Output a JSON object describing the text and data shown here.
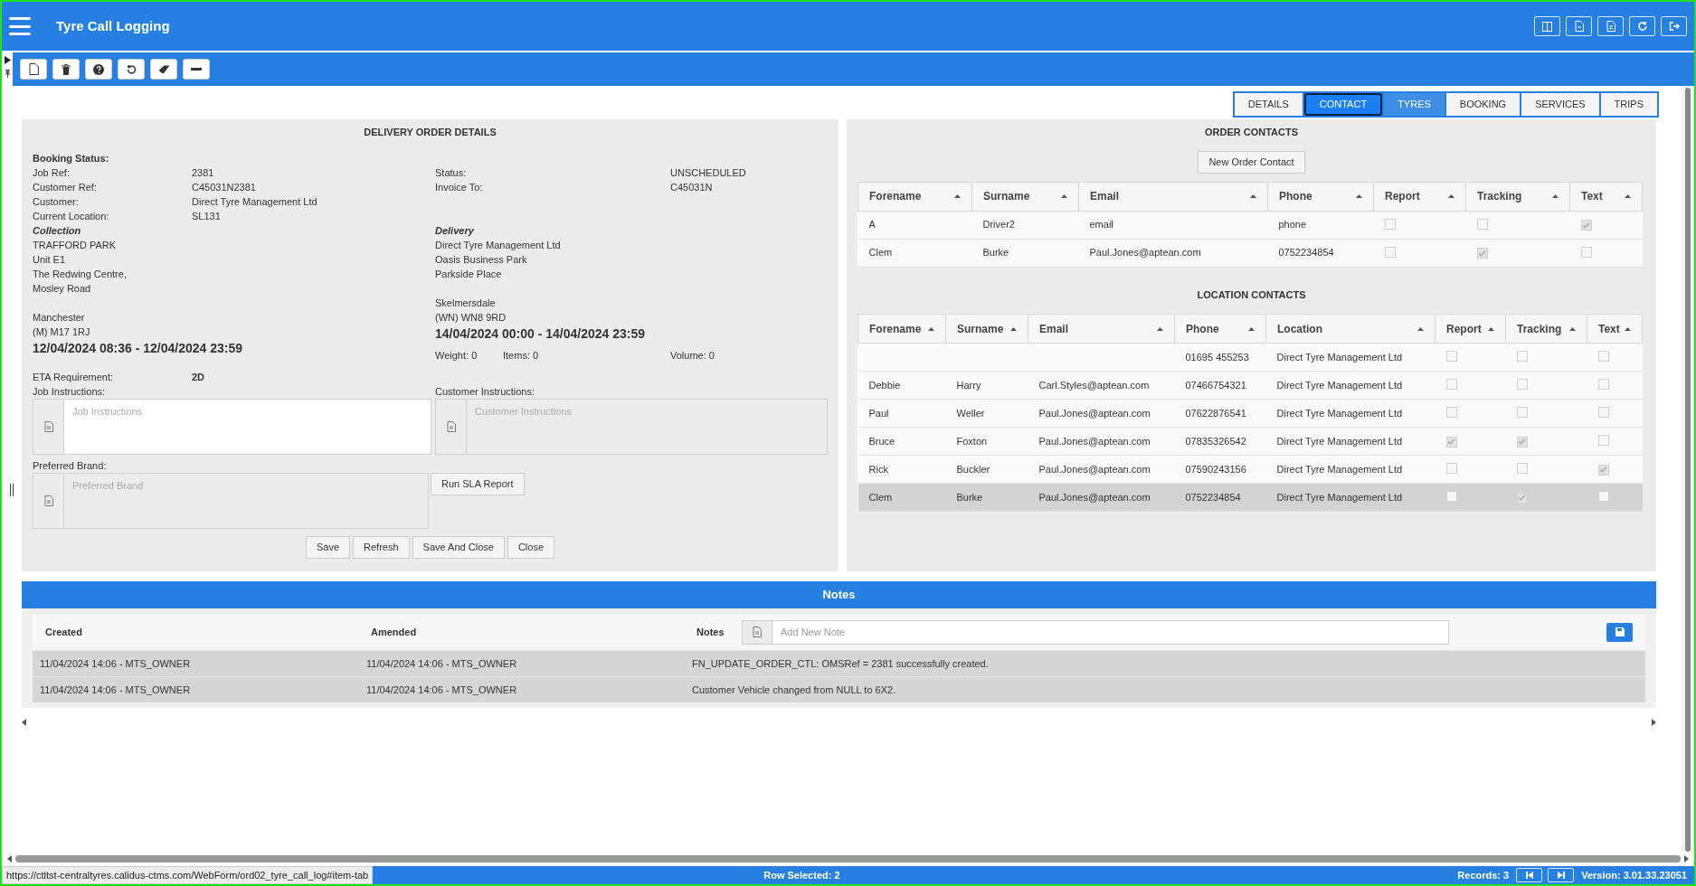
{
  "header": {
    "title": "Tyre Call Logging"
  },
  "tabs": [
    {
      "label": "DETAILS",
      "selected": false,
      "hovered": false
    },
    {
      "label": "CONTACT",
      "selected": true,
      "hovered": false
    },
    {
      "label": "TYRES",
      "selected": false,
      "hovered": true
    },
    {
      "label": "BOOKING",
      "selected": false,
      "hovered": false
    },
    {
      "label": "SERVICES",
      "selected": false,
      "hovered": false
    },
    {
      "label": "TRIPS",
      "selected": false,
      "hovered": false
    }
  ],
  "details": {
    "title": "DELIVERY ORDER DETAILS",
    "booking_status_label": "Booking Status:",
    "left_fields": [
      {
        "label": "Job Ref:",
        "value": "2381"
      },
      {
        "label": "Customer Ref:",
        "value": "C45031N2381"
      },
      {
        "label": "Customer:",
        "value": "Direct Tyre Management Ltd"
      },
      {
        "label": "Current Location:",
        "value": "SL131"
      }
    ],
    "right_fields": [
      {
        "label": "Status:",
        "value": "UNSCHEDULED"
      },
      {
        "label": "Invoice To:",
        "value": "C45031N"
      }
    ],
    "collection": {
      "heading": "Collection",
      "lines": [
        "TRAFFORD PARK",
        "Unit E1",
        "The Redwing Centre,",
        "Mosley Road"
      ],
      "town": "Manchester",
      "postcode": "(M) M17 1RJ",
      "window": "12/04/2024 08:36 - 12/04/2024 23:59"
    },
    "delivery": {
      "heading": "Delivery",
      "lines": [
        "Direct Tyre Management Ltd",
        "Oasis Business Park",
        "Parkside Place"
      ],
      "town": "Skelmersdale",
      "postcode": "(WN) WN8 9RD",
      "window": "14/04/2024 00:00 - 14/04/2024 23:59"
    },
    "weight": "Weight:  0",
    "items": "Items:  0",
    "volume": "Volume:  0",
    "eta_label": "ETA Requirement:",
    "eta_value": "2D",
    "job_instructions": {
      "label": "Job Instructions:",
      "placeholder": "Job Instructions",
      "disabled": false
    },
    "customer_instructions": {
      "label": "Customer Instructions:",
      "placeholder": "Customer Instructions",
      "disabled": true
    },
    "preferred_brand": {
      "label": "Preferred Brand:",
      "placeholder": "Preferred Brand",
      "disabled": true
    },
    "sla_button": "Run SLA Report",
    "buttons": [
      "Save",
      "Refresh",
      "Save And Close",
      "Close"
    ]
  },
  "order_contacts": {
    "title": "ORDER CONTACTS",
    "new_button": "New Order Contact",
    "columns": [
      "Forename",
      "Surname",
      "Email",
      "Phone",
      "Report",
      "Tracking",
      "Text"
    ],
    "rows": [
      {
        "forename": "A",
        "surname": "Driver2",
        "email": "email",
        "phone": "phone",
        "report": false,
        "tracking": false,
        "text": true
      },
      {
        "forename": "Clem",
        "surname": "Burke",
        "email": "Paul.Jones@aptean.com",
        "phone": "0752234854",
        "report": false,
        "tracking": true,
        "text": false
      }
    ]
  },
  "location_contacts": {
    "title": "LOCATION CONTACTS",
    "columns": [
      "Forename",
      "Surname",
      "Email",
      "Phone",
      "Location",
      "Report",
      "Tracking",
      "Text"
    ],
    "rows": [
      {
        "forename": "",
        "surname": "",
        "email": "",
        "phone": "01695 455253",
        "location": "Direct Tyre Management Ltd",
        "report": false,
        "tracking": false,
        "text": false,
        "selected": false
      },
      {
        "forename": "Debbie",
        "surname": "Harry",
        "email": "Carl.Styles@aptean.com",
        "phone": "07466754321",
        "location": "Direct Tyre Management Ltd",
        "report": false,
        "tracking": false,
        "text": false,
        "selected": false
      },
      {
        "forename": "Paul",
        "surname": "Weller",
        "email": "Paul.Jones@aptean.com",
        "phone": "07622876541",
        "location": "Direct Tyre Management Ltd",
        "report": false,
        "tracking": false,
        "text": false,
        "selected": false
      },
      {
        "forename": "Bruce",
        "surname": "Foxton",
        "email": "Paul.Jones@aptean.com",
        "phone": "07835326542",
        "location": "Direct Tyre Management Ltd",
        "report": true,
        "tracking": true,
        "text": false,
        "selected": false
      },
      {
        "forename": "Rick",
        "surname": "Buckler",
        "email": "Paul.Jones@aptean.com",
        "phone": "07590243156",
        "location": "Direct Tyre Management Ltd",
        "report": false,
        "tracking": false,
        "text": true,
        "selected": false
      },
      {
        "forename": "Clem",
        "surname": "Burke",
        "email": "Paul.Jones@aptean.com",
        "phone": "0752234854",
        "location": "Direct Tyre Management Ltd",
        "report": false,
        "tracking": true,
        "text": false,
        "selected": true
      }
    ]
  },
  "notes": {
    "title": "Notes",
    "columns": [
      "Created",
      "Amended",
      "Notes"
    ],
    "placeholder": "Add New Note",
    "rows": [
      {
        "created": "11/04/2024 14:06 - MTS_OWNER",
        "amended": "11/04/2024 14:06 - MTS_OWNER",
        "note": "FN_UPDATE_ORDER_CTL: OMSRef = 2381 successfully created."
      },
      {
        "created": "11/04/2024 14:06 - MTS_OWNER",
        "amended": "11/04/2024 14:06 - MTS_OWNER",
        "note": "Customer Vehicle changed from NULL to 6X2."
      }
    ]
  },
  "status_bar": {
    "url": "https://ctltst-centraltyres.calidus-ctms.com/WebForm/ord02_tyre_call_log#item-tab",
    "row_selected": "Row Selected: 2",
    "records": "Records: 3",
    "version": "Version: 3.01.33.23051"
  }
}
